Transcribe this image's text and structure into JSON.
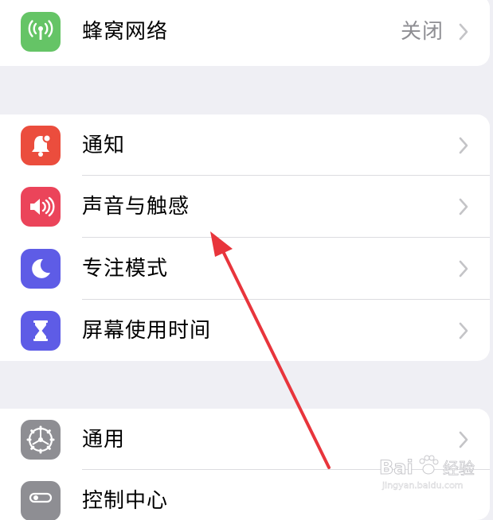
{
  "groups": [
    {
      "rows": [
        {
          "label": "蜂窝网络",
          "value": "关闭",
          "icon": "antenna-icon",
          "color": "#65c466"
        }
      ]
    },
    {
      "rows": [
        {
          "label": "通知",
          "icon": "bell-icon",
          "color": "#eb4d3d"
        },
        {
          "label": "声音与触感",
          "icon": "speaker-icon",
          "color": "#eb445a"
        },
        {
          "label": "专注模式",
          "icon": "moon-icon",
          "color": "#5e5ce6"
        },
        {
          "label": "屏幕使用时间",
          "icon": "hourglass-icon",
          "color": "#5e5ce6"
        }
      ]
    },
    {
      "rows": [
        {
          "label": "通用",
          "icon": "gear-icon",
          "color": "#8e8e93"
        },
        {
          "label": "控制中心",
          "icon": "toggle-icon",
          "color": "#8e8e93"
        }
      ]
    }
  ],
  "watermark": {
    "brand": "Bai",
    "brand2": "经验",
    "url": "jingyan.baidu.com"
  },
  "annotation": {
    "type": "arrow",
    "color": "#e8353c"
  }
}
